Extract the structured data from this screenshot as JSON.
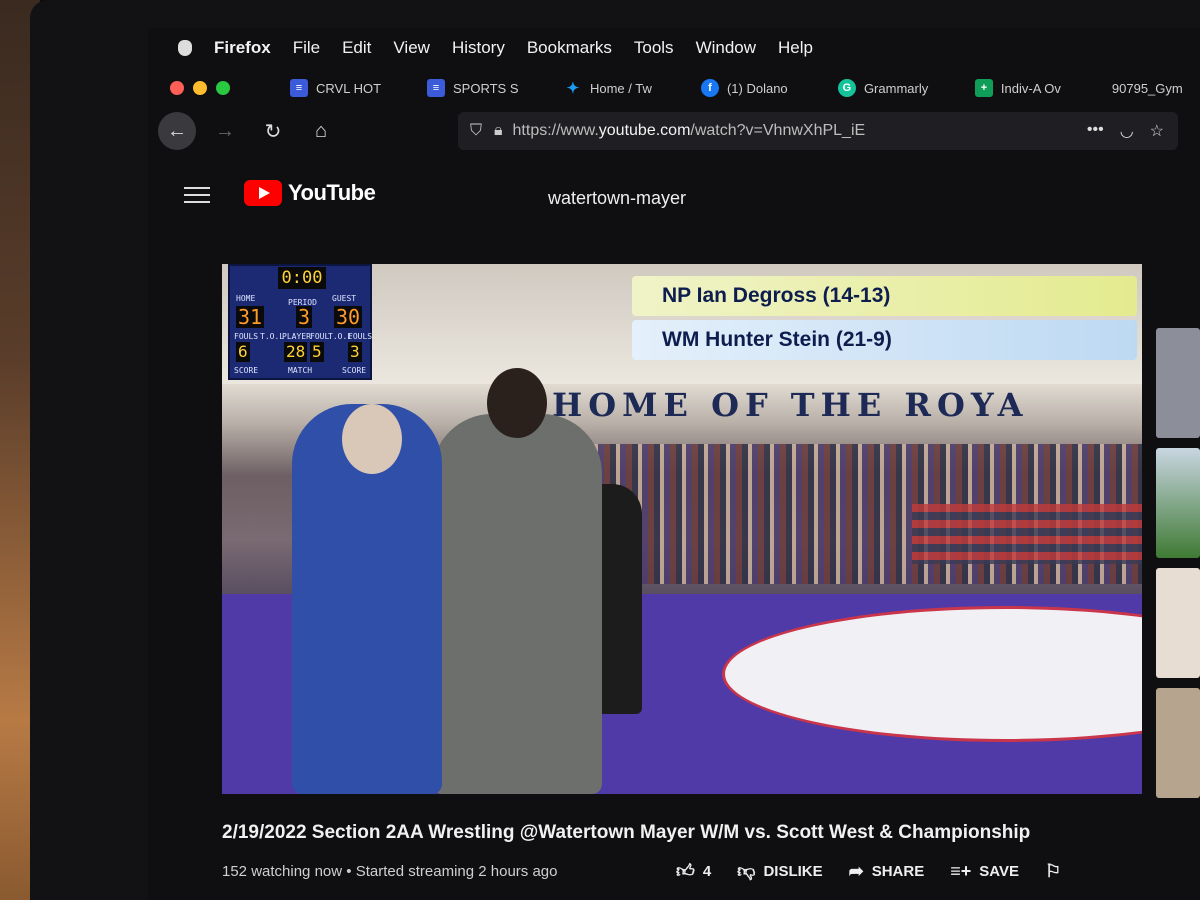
{
  "menubar": {
    "app": "Firefox",
    "items": [
      "File",
      "Edit",
      "View",
      "History",
      "Bookmarks",
      "Tools",
      "Window",
      "Help"
    ]
  },
  "tabs": [
    {
      "label": "CRVL HOT",
      "favicon_color": "#3b5bdb",
      "icon": "list-icon"
    },
    {
      "label": "SPORTS S",
      "favicon_color": "#3b5bdb",
      "icon": "list-icon"
    },
    {
      "label": "Home / Tw",
      "favicon_color": "#1d9bf0",
      "icon": "twitter-icon"
    },
    {
      "label": "(1) Dolano",
      "favicon_color": "#1877f2",
      "icon": "facebook-icon"
    },
    {
      "label": "Grammarly",
      "favicon_color": "#15c39a",
      "icon": "grammarly-icon"
    },
    {
      "label": "Indiv-A Ov",
      "favicon_color": "#0f9d58",
      "icon": "sheets-icon"
    },
    {
      "label": "90795_Gym",
      "favicon_color": "",
      "icon": ""
    }
  ],
  "url": {
    "prefix": "https://www.",
    "domain": "youtube.com",
    "path": "/watch?v=VhnwXhPL_iE"
  },
  "youtube": {
    "logo_text": "YouTube",
    "search_query": "watertown-mayer"
  },
  "scoreboard": {
    "clock": "0:00",
    "home_label": "HOME",
    "guest_label": "GUEST",
    "period_label": "PERIOD",
    "home_score": "31",
    "guest_score": "30",
    "period": "3",
    "home_fouls": "6",
    "guest_fouls": "3",
    "player_foul": "28",
    "match": "5",
    "small_labels": [
      "FOULS",
      "T.O.L",
      "PLAYER",
      "FOUL",
      "T.O.L",
      "FOULS",
      "SCORE",
      "MATCH",
      "SCORE"
    ]
  },
  "lower_third": {
    "line1": "NP Ian Degross (14-13)",
    "line2": "WM Hunter Stein (21-9)"
  },
  "arena_banner": "HOME OF THE ROYA",
  "video": {
    "title": "2/19/2022 Section 2AA Wrestling @Watertown Mayer W/M vs. Scott West & Championship",
    "watching": "152 watching now",
    "separator": "•",
    "started": "Started streaming 2 hours ago",
    "likes": "4",
    "dislike_label": "DISLIKE",
    "share_label": "SHARE",
    "save_label": "SAVE"
  }
}
